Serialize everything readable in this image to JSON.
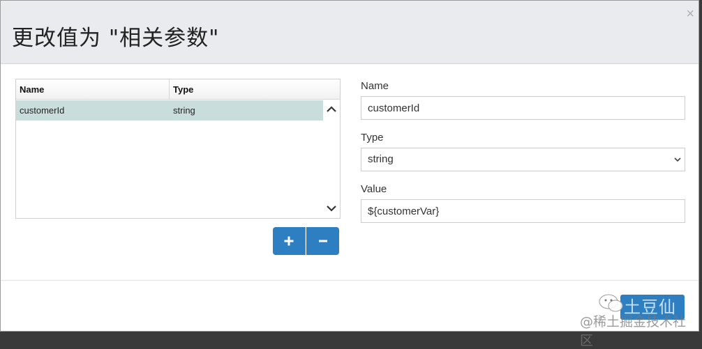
{
  "dialog": {
    "title": "更改值为 \"相关参数\"",
    "close_symbol": "×"
  },
  "grid": {
    "columns": [
      "Name",
      "Type"
    ],
    "rows": [
      {
        "name": "customerId",
        "type": "string"
      }
    ],
    "scroll_up_icon": "chevron-up-icon",
    "scroll_down_icon": "chevron-down-icon"
  },
  "buttons": {
    "add_icon": "plus-icon",
    "remove_icon": "minus-icon",
    "accent_color": "#2e7fc1"
  },
  "form": {
    "name_label": "Name",
    "name_value": "customerId",
    "type_label": "Type",
    "type_value": "string",
    "value_label": "Value",
    "value_value": "${customerVar}"
  },
  "watermark": {
    "top_text": "土豆仙",
    "bottom_text": "@稀土掘金技术社区"
  },
  "colors": {
    "header_bg": "#e9ebee",
    "selected_row": "#c9dddd"
  }
}
